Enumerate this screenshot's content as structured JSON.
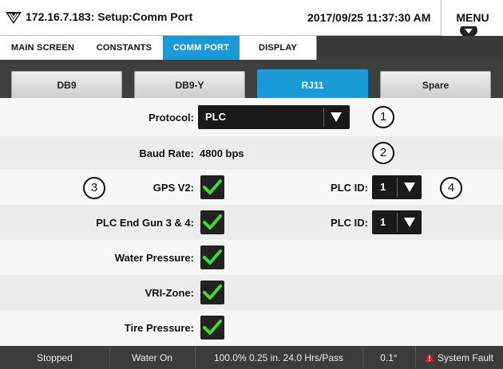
{
  "header": {
    "title": "172.16.7.183: Setup:Comm Port",
    "datetime": "2017/09/25 11:37:30 AM",
    "menu_label": "MENU"
  },
  "main_tabs": [
    {
      "label": "MAIN SCREEN",
      "active": false
    },
    {
      "label": "CONSTANTS",
      "active": false
    },
    {
      "label": "COMM PORT",
      "active": true
    },
    {
      "label": "DISPLAY",
      "active": false
    }
  ],
  "sub_tabs": [
    {
      "label": "DB9",
      "active": false
    },
    {
      "label": "DB9-Y",
      "active": false
    },
    {
      "label": "RJ11",
      "active": true
    },
    {
      "label": "Spare",
      "active": false
    }
  ],
  "settings": {
    "protocol": {
      "label": "Protocol:",
      "value": "PLC",
      "callout": "1"
    },
    "baud_rate": {
      "label": "Baud Rate:",
      "value": "4800 bps",
      "callout": "2"
    },
    "gps_v2": {
      "label": "GPS V2:",
      "checked": true,
      "callout": "3"
    },
    "gps_plc_id": {
      "label": "PLC ID:",
      "value": "1",
      "callout": "4"
    },
    "plc_end_gun": {
      "label": "PLC End Gun 3 & 4:",
      "checked": true
    },
    "end_gun_plc_id": {
      "label": "PLC ID:",
      "value": "1"
    },
    "water_pressure": {
      "label": "Water Pressure:",
      "checked": true
    },
    "vri_zone": {
      "label": "VRI-Zone:",
      "checked": true
    },
    "tire_pressure": {
      "label": "Tire Pressure:",
      "checked": true
    }
  },
  "status_bar": {
    "state": "Stopped",
    "water": "Water On",
    "pass_info": "100.0%  0.25 in.  24.0 Hrs/Pass",
    "angle": "0.1°",
    "fault": "System Fault"
  },
  "colors": {
    "accent": "#1a9ad6",
    "check": "#3ddc2e",
    "fault_icon": "#e02020",
    "dark": "#3c3c3c"
  },
  "icons": {
    "logo": "valley-logo-icon",
    "checkbox": "check-icon",
    "dropdown": "triangle-down-icon",
    "fault": "warning-triangle-icon"
  }
}
